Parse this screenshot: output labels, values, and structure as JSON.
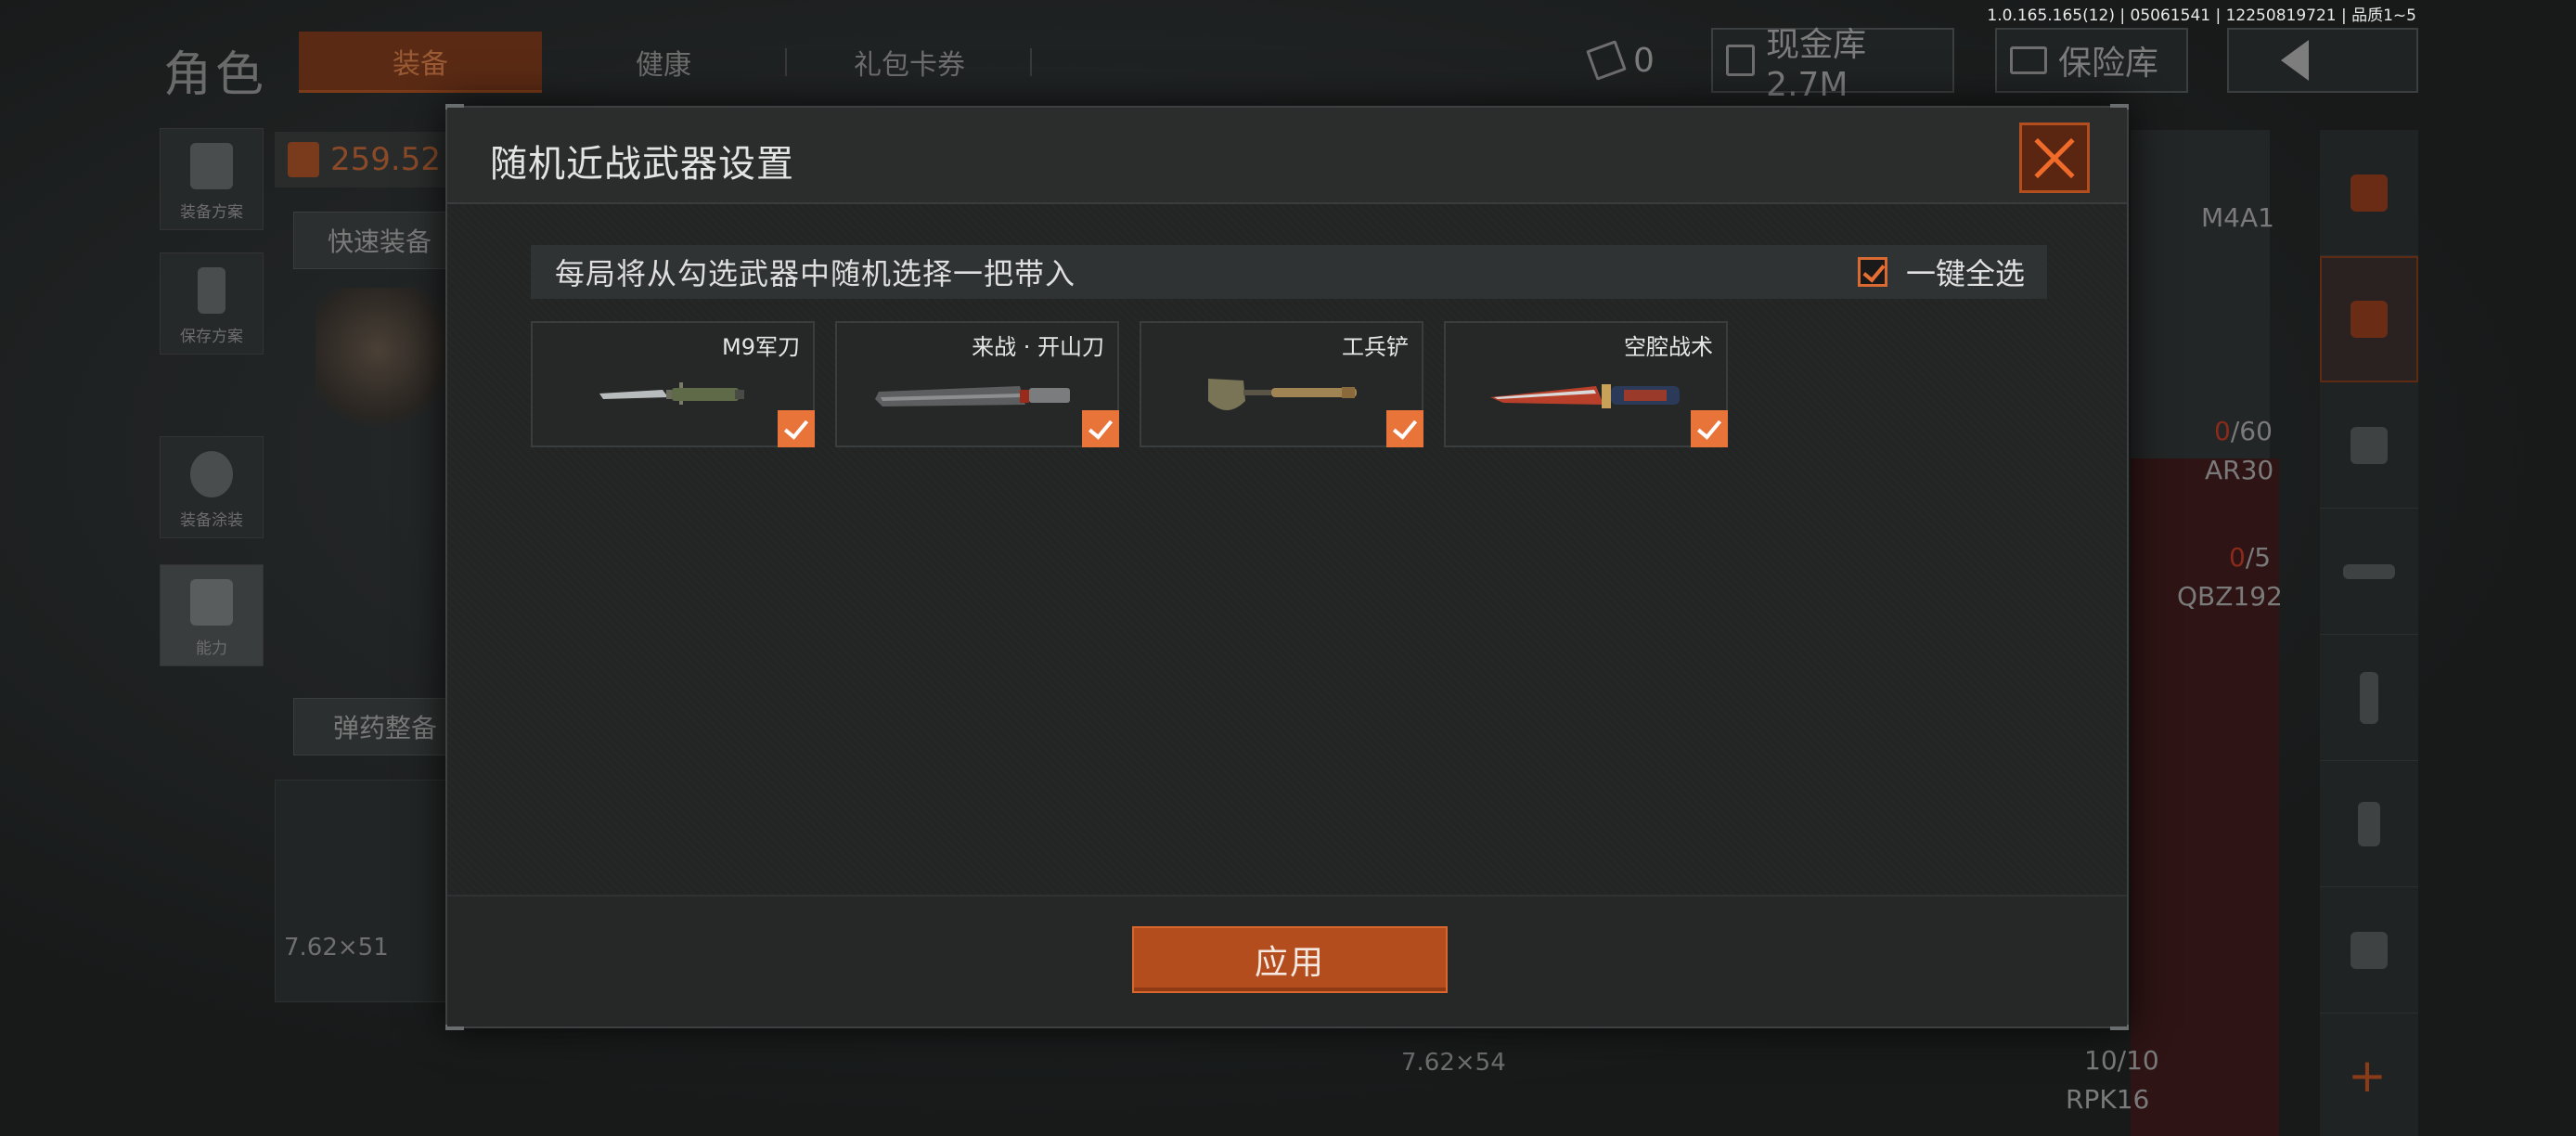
{
  "version": "1.0.165.165(12) | 05061541 | 12250819721 | 品质1~5",
  "background": {
    "page_title": "角色",
    "tabs": [
      "装备",
      "健康",
      "礼包卡券"
    ],
    "ticket_count": "0",
    "cash_label": "现金库 2.7M",
    "vault_label": "保险库",
    "left_nav": [
      "装备方案",
      "保存方案",
      "装备涂装",
      "能力"
    ],
    "resource_value": "259.52",
    "quick_equip_label": "快速装备",
    "ammo_label": "弹药整备",
    "caliber_left": "7.62×51",
    "caliber_bottom": "7.62×54",
    "weapons": [
      {
        "name": "M4A1",
        "count_used": "0",
        "count_total": "/60"
      },
      {
        "name": "AR30",
        "count_used": "0",
        "count_total": "/5"
      },
      {
        "name": "QBZ192"
      },
      {
        "name": "RPK16",
        "count": "10/10"
      }
    ]
  },
  "modal": {
    "title": "随机近战武器设置",
    "info": "每局将从勾选武器中随机选择一把带入",
    "select_all_label": "一键全选",
    "items": [
      {
        "name": "M9军刀",
        "checked": true
      },
      {
        "name": "来战 · 开山刀",
        "checked": true
      },
      {
        "name": "工兵铲",
        "checked": true
      },
      {
        "name": "空腔战术",
        "checked": true
      }
    ],
    "apply_label": "应用"
  },
  "colors": {
    "accent": "#e8743a",
    "button": "#b34d1e",
    "modal_bg": "#232424"
  }
}
